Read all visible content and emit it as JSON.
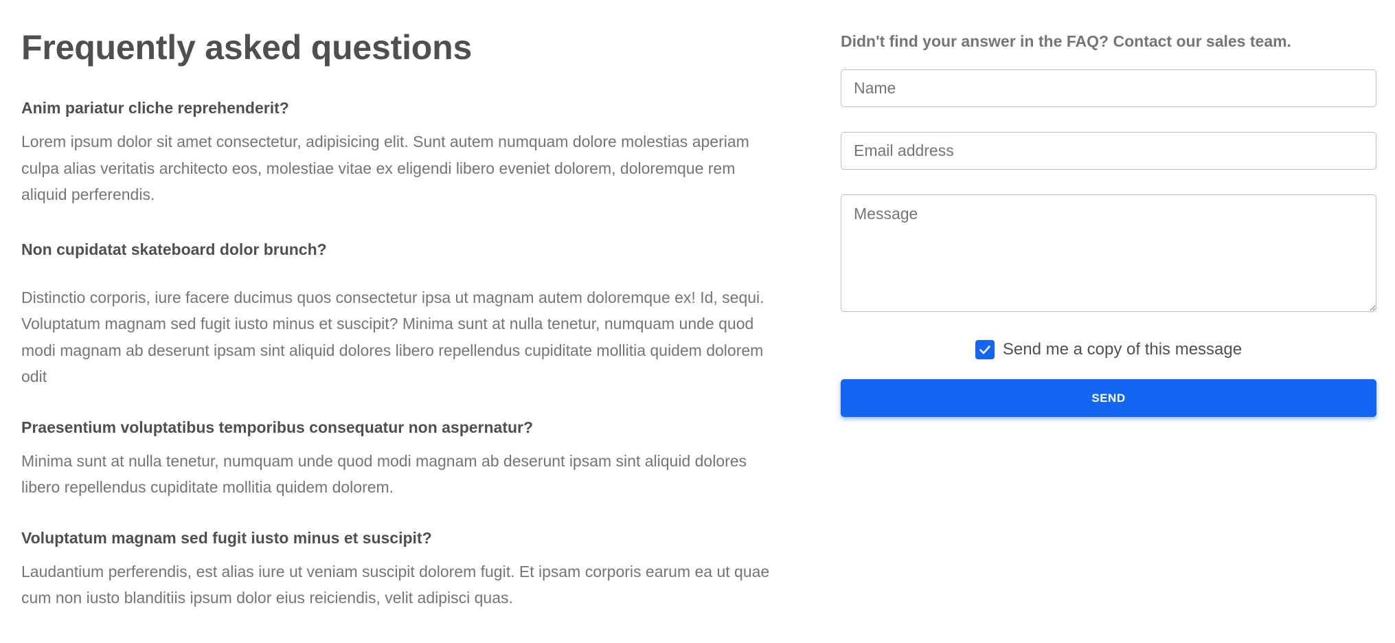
{
  "faq": {
    "title": "Frequently asked questions",
    "items": [
      {
        "question": "Anim pariatur cliche reprehenderit?",
        "answer": "Lorem ipsum dolor sit amet consectetur, adipisicing elit. Sunt autem numquam dolore molestias aperiam culpa alias veritatis architecto eos, molestiae vitae ex eligendi libero eveniet dolorem, doloremque rem aliquid perferendis."
      },
      {
        "question": "Non cupidatat skateboard dolor brunch?",
        "answer": "Distinctio corporis, iure facere ducimus quos consectetur ipsa ut magnam autem doloremque ex! Id, sequi. Voluptatum magnam sed fugit iusto minus et suscipit? Minima sunt at nulla tenetur, numquam unde quod modi magnam ab deserunt ipsam sint aliquid dolores libero repellendus cupiditate mollitia quidem dolorem odit"
      },
      {
        "question": "Praesentium voluptatibus temporibus consequatur non aspernatur?",
        "answer": "Minima sunt at nulla tenetur, numquam unde quod modi magnam ab deserunt ipsam sint aliquid dolores libero repellendus cupiditate mollitia quidem dolorem."
      },
      {
        "question": "Voluptatum magnam sed fugit iusto minus et suscipit?",
        "answer": "Laudantium perferendis, est alias iure ut veniam suscipit dolorem fugit. Et ipsam corporis earum ea ut quae cum non iusto blanditiis ipsum dolor eius reiciendis, velit adipisci quas."
      }
    ]
  },
  "contact": {
    "heading": "Didn't find your answer in the FAQ? Contact our sales team.",
    "name_placeholder": "Name",
    "name_value": "",
    "email_placeholder": "Email address",
    "email_value": "",
    "message_placeholder": "Message",
    "message_value": "",
    "copy_checkbox_label": "Send me a copy of this message",
    "copy_checkbox_checked": true,
    "send_label": "SEND"
  },
  "icons": {
    "checkbox": "check-icon"
  },
  "colors": {
    "accent": "#1266f1",
    "heading_text": "#4f4f4f",
    "body_text": "#757575",
    "input_border": "#bdbdbd"
  }
}
